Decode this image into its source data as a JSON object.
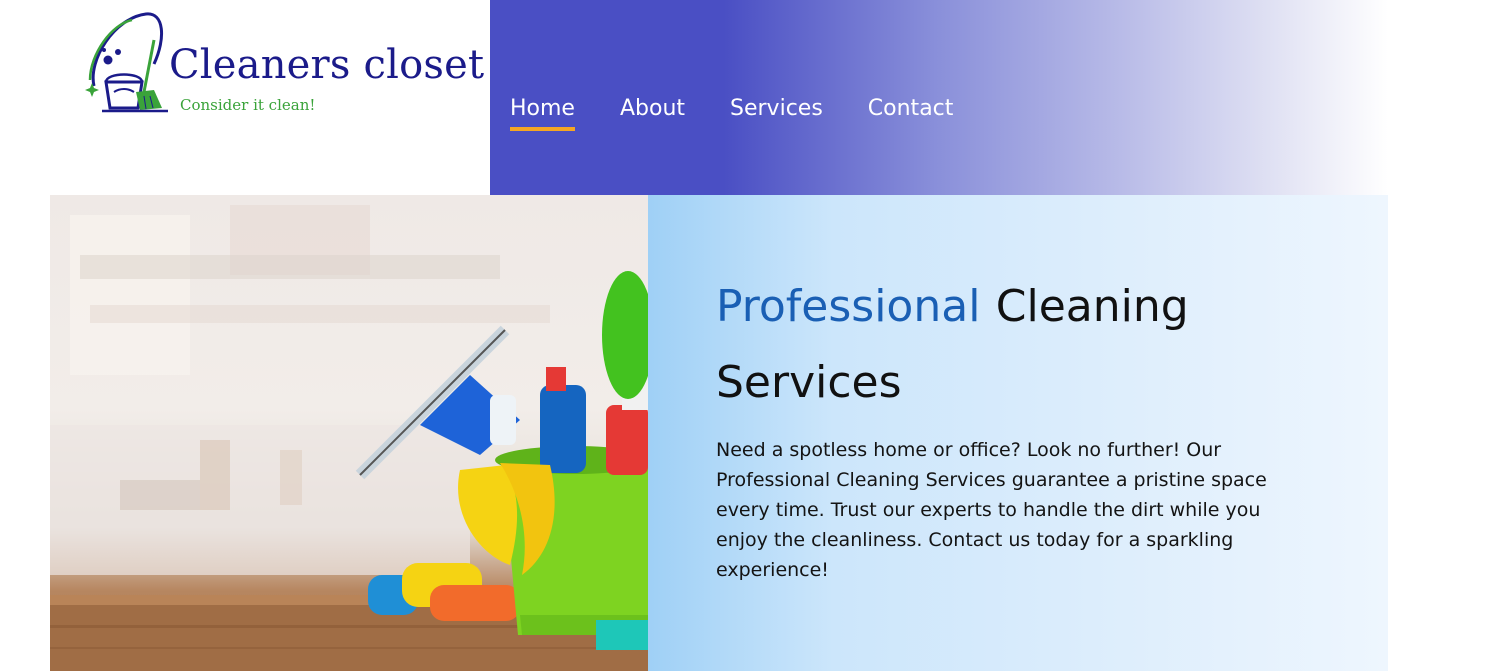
{
  "brand": {
    "name": "Cleaners closet",
    "tagline": "Consider it clean!",
    "logo_icon": "cleaning-bucket-broom-logo",
    "colors": {
      "name": "#1b1b8a",
      "tagline": "#3aa33a"
    }
  },
  "nav": {
    "items": [
      {
        "label": "Home",
        "active": true
      },
      {
        "label": "About",
        "active": false
      },
      {
        "label": "Services",
        "active": false
      },
      {
        "label": "Contact",
        "active": false
      }
    ],
    "colors": {
      "background": "#4a4fc4",
      "underline": "#f5a623",
      "text": "#ffffff"
    }
  },
  "hero": {
    "title_accent": "Professional",
    "title_rest": "Cleaning Services",
    "description": "Need a spotless home or office? Look no further! Our Professional Cleaning Services guarantee a pristine space every time. Trust our experts to handle the dirt while you enjoy the cleanliness. Contact us today for a sparkling experience!",
    "image_subject": "cleaning-supplies-bucket-photo",
    "colors": {
      "accent": "#1a5fb4",
      "background": "#cce6fb"
    }
  }
}
